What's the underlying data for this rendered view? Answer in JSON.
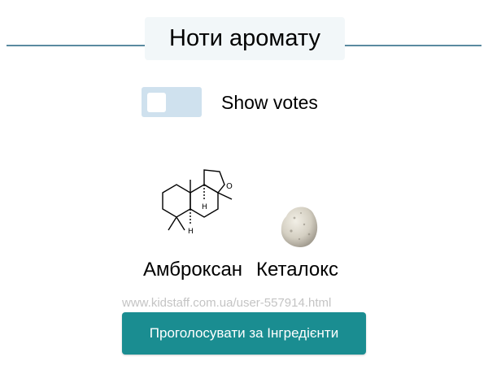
{
  "header": {
    "title": "Ноти аромату"
  },
  "toggle": {
    "label": "Show votes",
    "checked": false
  },
  "notes": [
    {
      "name": "Амброксан",
      "icon": "ambroxan-molecule-icon"
    },
    {
      "name": "Кеталокс",
      "icon": "ketalox-stone-image"
    }
  ],
  "watermark": "www.kidstaff.com.ua/user-557914.html",
  "vote_button": {
    "label": "Проголосувати за Інгредієнти"
  },
  "colors": {
    "accent": "#1a8d91",
    "line": "#5a8aa0",
    "toggle_bg": "#cfe1ee",
    "title_bg": "#f2f7f9"
  }
}
